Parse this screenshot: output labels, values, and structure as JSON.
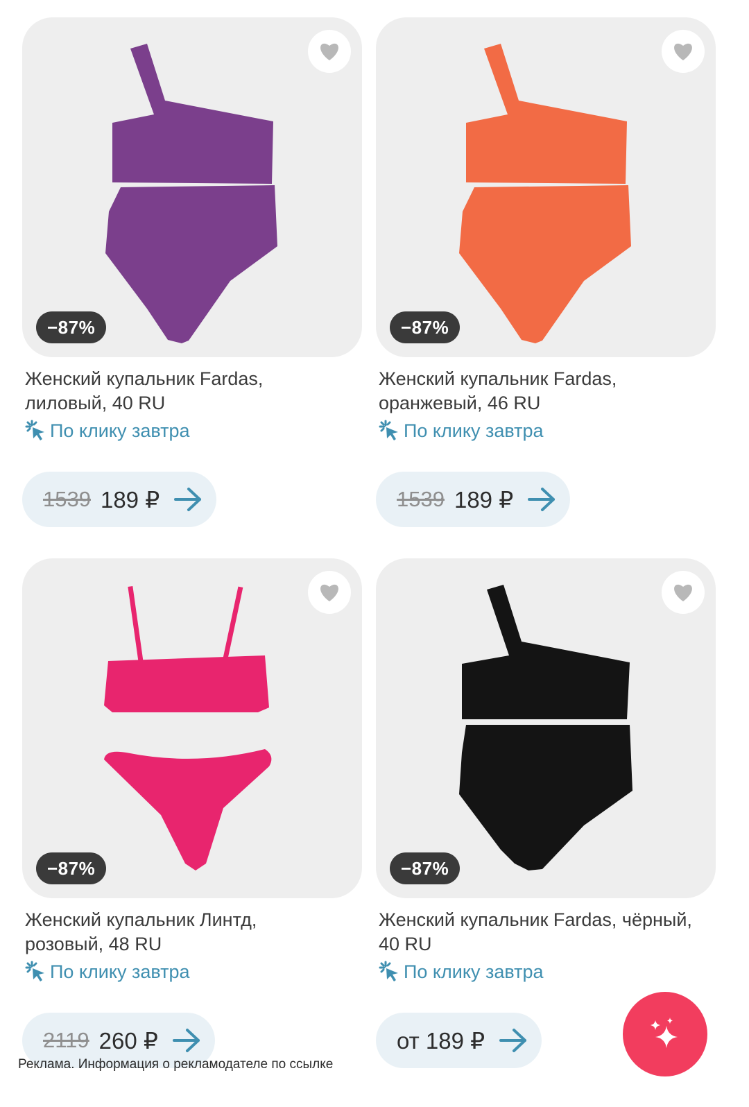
{
  "products": [
    {
      "title_line1": "Женский купальник Fardas,",
      "title_line2": "лиловый, 40 RU",
      "discount": "−87%",
      "delivery": "По клику завтра",
      "old_price": "1539",
      "price": "189 ₽",
      "color": "#7b3f8c",
      "style": "one-shoulder-highwaist"
    },
    {
      "title_line1": "Женский купальник Fardas,",
      "title_line2": "оранжевый, 46 RU",
      "discount": "−87%",
      "delivery": "По клику завтра",
      "old_price": "1539",
      "price": "189 ₽",
      "color": "#f26b45",
      "style": "one-shoulder-highwaist"
    },
    {
      "title_line1": "Женский купальник Линтд,",
      "title_line2": "розовый, 48 RU",
      "discount": "−87%",
      "delivery": "По клику завтра",
      "old_price": "2119",
      "price": "260 ₽",
      "color": "#e8256e",
      "style": "bandeau-straps-brief"
    },
    {
      "title_line1": "Женский купальник Fardas, чёрный,",
      "title_line2": "40 RU",
      "discount": "−87%",
      "delivery": "По клику завтра",
      "old_price": "",
      "price": "от 189 ₽",
      "color": "#141414",
      "style": "one-shoulder-highwaist"
    }
  ],
  "ad_note": "Реклама. Информация о рекламодателе по ссылке",
  "icons": {
    "favorite": "heart-icon",
    "delivery": "click-sparkle-icon",
    "go": "arrow-right-icon",
    "fab": "sparkles-icon"
  },
  "colors": {
    "accent_blue": "#3f8fb0",
    "price_pill_bg": "#e9f1f6",
    "fab_bg": "#f23d5e",
    "badge_bg": "#3a3a3a"
  }
}
